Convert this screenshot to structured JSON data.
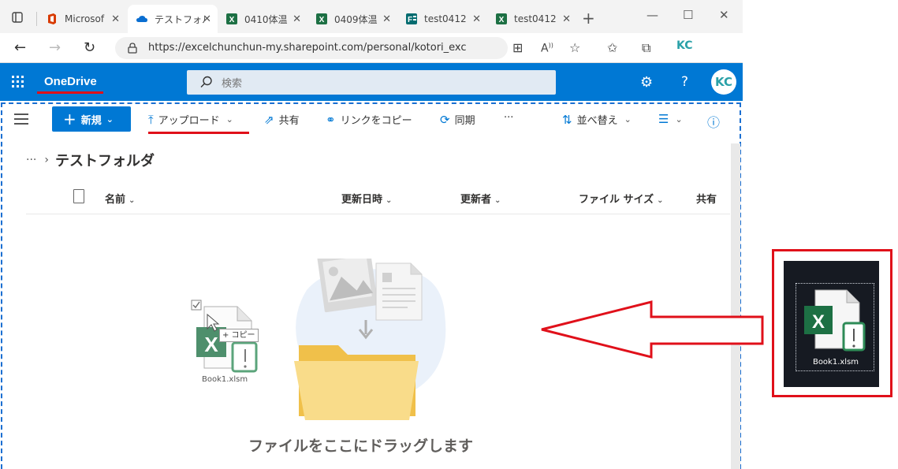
{
  "browser": {
    "tabs": [
      {
        "title": "Microsof",
        "icon": "office-icon"
      },
      {
        "title": "テストフォル",
        "icon": "onedrive-icon",
        "active": true
      },
      {
        "title": "0410体温",
        "icon": "excel-icon"
      },
      {
        "title": "0409体温",
        "icon": "excel-icon"
      },
      {
        "title": "test0412",
        "icon": "forms-icon"
      },
      {
        "title": "test0412",
        "icon": "excel-icon"
      }
    ],
    "new_tab": "+",
    "url": "https://excelchunchun-my.sharepoint.com/personal/kotori_excelchunc...",
    "profile": "KC"
  },
  "header": {
    "brand": "OneDrive",
    "search_placeholder": "検索",
    "avatar": "KC",
    "brand_color": "#0078d4"
  },
  "commands": {
    "new": "新規",
    "upload": "アップロード",
    "share": "共有",
    "copy_link": "リンクをコピー",
    "sync": "同期",
    "more": "···",
    "sort": "並べ替え"
  },
  "breadcrumb": {
    "dots": "···",
    "current": "テストフォルダ"
  },
  "columns": {
    "name": "名前",
    "modified": "更新日時",
    "modified_by": "更新者",
    "file_size": "ファイル サイズ",
    "sharing": "共有"
  },
  "empty_state": {
    "message": "ファイルをここにドラッグします"
  },
  "drag": {
    "file_name": "Book1.xlsm",
    "tooltip": "+ コピー"
  },
  "desktop": {
    "file_name": "Book1.xlsm"
  }
}
